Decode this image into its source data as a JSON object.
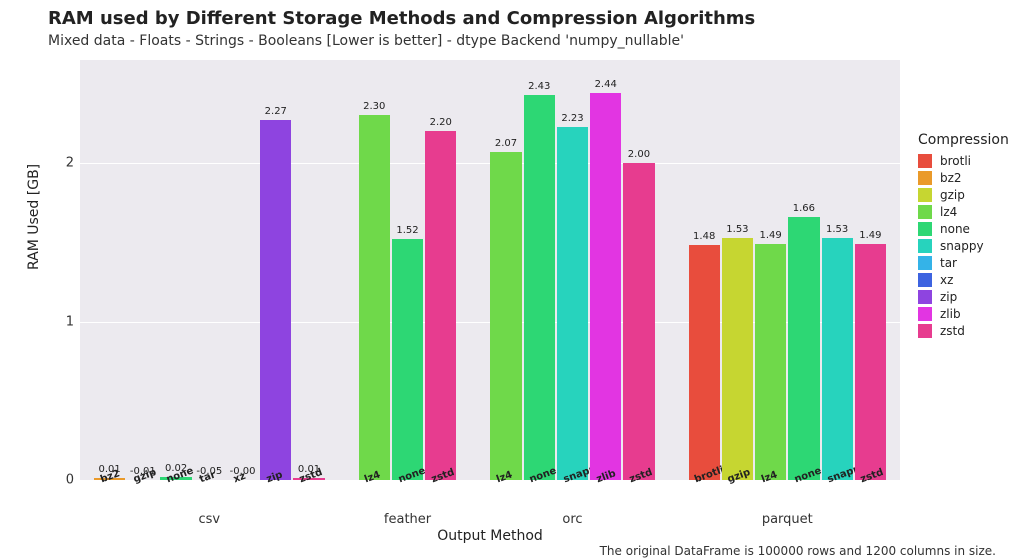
{
  "title": "RAM used by Different Storage Methods and Compression Algorithms",
  "subtitle": "Mixed data - Floats - Strings - Booleans [Lower is better] - dtype Backend 'numpy_nullable'",
  "xlabel": "Output Method",
  "ylabel": "RAM Used [GB]",
  "caption": "The original DataFrame is 100000 rows and 1200 columns in size.",
  "legend_title": "Compression",
  "y_ticks": [
    0,
    1,
    2
  ],
  "y_max": 2.65,
  "colors": {
    "brotli": "#e84d3d",
    "bz2": "#ea9a2a",
    "gzip": "#c6d631",
    "lz4": "#6fd94a",
    "none": "#2dd774",
    "snappy": "#27d3bd",
    "tar": "#34b3e8",
    "xz": "#3d63e0",
    "zip": "#8e44e0",
    "zlib": "#e235e2",
    "zstd": "#e73c8f"
  },
  "compressions": [
    "brotli",
    "bz2",
    "gzip",
    "lz4",
    "none",
    "snappy",
    "tar",
    "xz",
    "zip",
    "zstd",
    "zlib"
  ],
  "legend_order": [
    "brotli",
    "bz2",
    "gzip",
    "lz4",
    "none",
    "snappy",
    "tar",
    "xz",
    "zip",
    "zlib",
    "zstd"
  ],
  "chart_data": {
    "type": "bar",
    "title": "RAM used by Different Storage Methods and Compression Algorithms",
    "xlabel": "Output Method",
    "ylabel": "RAM Used [GB]",
    "ylim": [
      0,
      2.65
    ],
    "groups": [
      {
        "name": "csv",
        "bars": [
          {
            "compression": "bz2",
            "value": 0.01,
            "label": "0.01"
          },
          {
            "compression": "gzip",
            "value": -0.01,
            "label": "-0.01"
          },
          {
            "compression": "none",
            "value": 0.02,
            "label": "0.02"
          },
          {
            "compression": "tar",
            "value": -0.05,
            "label": "-0.05"
          },
          {
            "compression": "xz",
            "value": -0.0,
            "label": "-0.00"
          },
          {
            "compression": "zip",
            "value": 2.27,
            "label": "2.27"
          },
          {
            "compression": "zstd",
            "value": 0.01,
            "label": "0.01"
          }
        ]
      },
      {
        "name": "feather",
        "bars": [
          {
            "compression": "lz4",
            "value": 2.3,
            "label": "2.30"
          },
          {
            "compression": "none",
            "value": 1.52,
            "label": "1.52"
          },
          {
            "compression": "zstd",
            "value": 2.2,
            "label": "2.20"
          }
        ]
      },
      {
        "name": "orc",
        "bars": [
          {
            "compression": "lz4",
            "value": 2.07,
            "label": "2.07"
          },
          {
            "compression": "none",
            "value": 2.43,
            "label": "2.43"
          },
          {
            "compression": "snappy",
            "value": 2.23,
            "label": "2.23"
          },
          {
            "compression": "zlib",
            "value": 2.44,
            "label": "2.44"
          },
          {
            "compression": "zstd",
            "value": 2.0,
            "label": "2.00"
          }
        ]
      },
      {
        "name": "parquet",
        "bars": [
          {
            "compression": "brotli",
            "value": 1.48,
            "label": "1.48"
          },
          {
            "compression": "gzip",
            "value": 1.53,
            "label": "1.53"
          },
          {
            "compression": "lz4",
            "value": 1.49,
            "label": "1.49"
          },
          {
            "compression": "none",
            "value": 1.66,
            "label": "1.66"
          },
          {
            "compression": "snappy",
            "value": 1.53,
            "label": "1.53"
          },
          {
            "compression": "zstd",
            "value": 1.49,
            "label": "1.49"
          }
        ]
      }
    ]
  }
}
